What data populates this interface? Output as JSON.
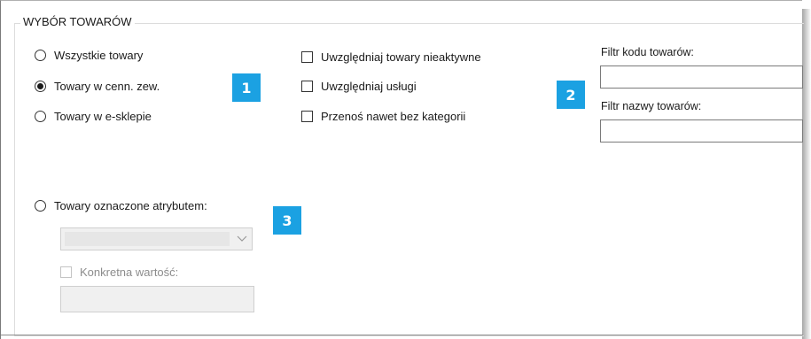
{
  "group": {
    "title": "WYBÓR TOWARÓW"
  },
  "radios": [
    {
      "label": "Wszystkie towary",
      "checked": false
    },
    {
      "label": "Towary w cenn. zew.",
      "checked": true
    },
    {
      "label": "Towary w e-sklepie",
      "checked": false
    },
    {
      "label": "Towary oznaczone atrybutem:",
      "checked": false
    }
  ],
  "checkboxes": [
    {
      "label": "Uwzględniaj towary nieaktywne",
      "checked": false
    },
    {
      "label": "Uwzględniaj usługi",
      "checked": false
    },
    {
      "label": "Przenoś nawet bez kategorii",
      "checked": false
    }
  ],
  "filters": {
    "code_label": "Filtr kodu towarów:",
    "code_value": "",
    "name_label": "Filtr nazwy towarów:",
    "name_value": ""
  },
  "attribute": {
    "combo_value": "",
    "combo_arrow_icon": "chevron-down-icon",
    "specific_value_label": "Konkretna wartość:",
    "specific_value": ""
  },
  "badges": [
    "1",
    "2",
    "3"
  ],
  "colors": {
    "badge": "#1ba1e2"
  }
}
